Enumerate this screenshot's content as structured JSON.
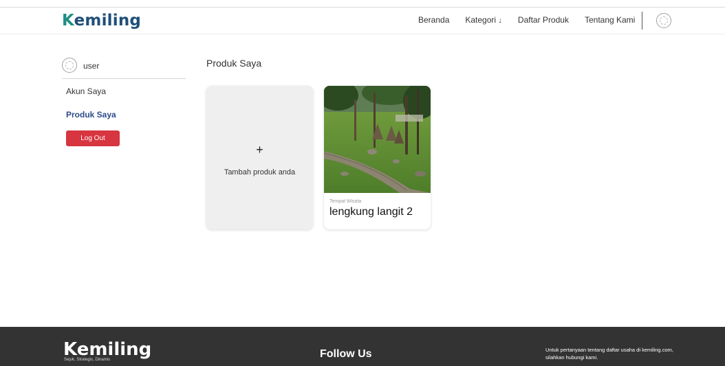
{
  "header": {
    "logo_first": "K",
    "logo_rest": "emiling",
    "nav": [
      {
        "label": "Beranda"
      },
      {
        "label": "Kategori",
        "arrow": "↓"
      },
      {
        "label": "Daftar Produk"
      },
      {
        "label": "Tentang Kami"
      }
    ]
  },
  "sidebar": {
    "username": "user",
    "items": [
      {
        "label": "Akun Saya",
        "active": false
      },
      {
        "label": "Produk Saya",
        "active": true
      }
    ],
    "logout_label": "Log Out"
  },
  "main": {
    "title": "Produk Saya",
    "add_card": {
      "plus": "+",
      "label": "Tambah produk anda"
    },
    "products": [
      {
        "category": "Tempat Wisata",
        "name": "lengkung langit 2"
      }
    ]
  },
  "footer": {
    "logo": "Kemiling",
    "tagline": "Sejuk, Strategis, Dinamis",
    "follow": "Follow Us",
    "contact": "Untuk pertanyaan tentang daftar usaha di kemiling.com, silahkan hubungi kami."
  },
  "colors": {
    "accent": "#2b4a8a",
    "logout": "#d7353f",
    "footer_bg": "#333333",
    "logo_teal": "#1f8f84",
    "logo_navy": "#1f4f7a"
  }
}
